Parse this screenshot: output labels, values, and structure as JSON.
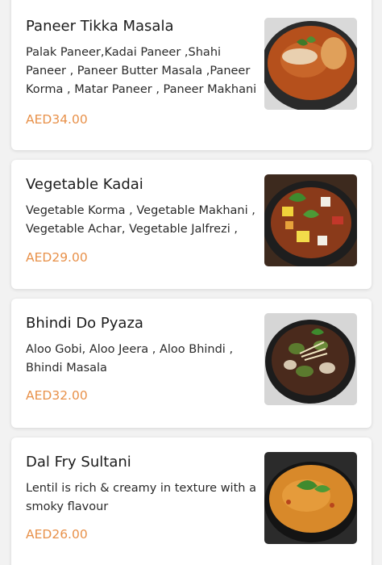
{
  "menu": {
    "items": [
      {
        "name": "Paneer Tikka Masala",
        "description": "Palak Paneer,Kadai Paneer ,Shahi Paneer , Paneer Butter Masala ,Paneer Korma , Matar Paneer , Paneer Makhani",
        "price": "AED34.00",
        "image_icon": "curry-dish-image"
      },
      {
        "name": "Vegetable Kadai",
        "description": "Vegetable Korma , Vegetable Makhani , Vegetable Achar, Vegetable Jalfrezi ,",
        "price": "AED29.00",
        "image_icon": "vegetable-dish-image"
      },
      {
        "name": "Bhindi Do Pyaza",
        "description": "Aloo Gobi, Aloo Jeera , Aloo Bhindi , Bhindi Masala",
        "price": "AED32.00",
        "image_icon": "okra-dish-image"
      },
      {
        "name": "Dal Fry Sultani",
        "description": "Lentil is rich & creamy in texture with a smoky flavour",
        "price": "AED26.00",
        "image_icon": "dal-bowl-image"
      }
    ]
  },
  "colors": {
    "price": "#e8914a",
    "card": "#ffffff",
    "background": "#f2f2f2"
  }
}
